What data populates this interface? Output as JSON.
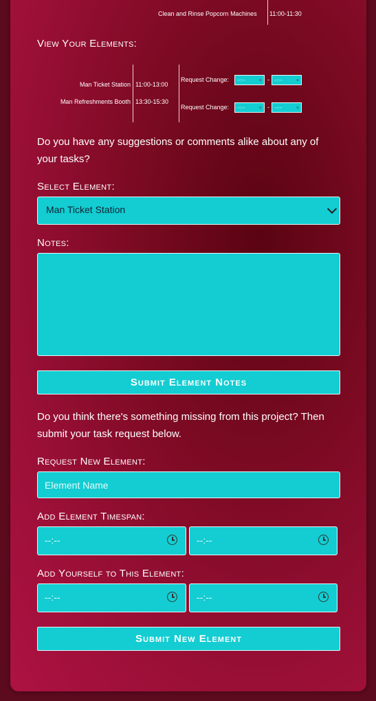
{
  "top_table": {
    "task": "Clean and Rinse Popcorn Machines",
    "time": "11:00-11:30"
  },
  "view_elements": {
    "heading": "View Your Elements:",
    "rows": [
      {
        "name": "Man Ticket Station",
        "time": "11:00-13:00"
      },
      {
        "name": "Man Refreshments Booth",
        "time": "13:30-15:30"
      }
    ],
    "request_change_label": "Request Change:",
    "separator": "-",
    "time_placeholder": "--:--",
    "clear_glyph": "×"
  },
  "suggestions": {
    "prompt": "Do you have any suggestions or comments alike about any of your tasks?",
    "select_label": "Select Element:",
    "select_value": "Man Ticket Station",
    "notes_label": "Notes:",
    "notes_value": "",
    "submit_label": "Submit Element Notes"
  },
  "new_element": {
    "prompt": "Do you think there's something missing from this project? Then submit your task request below.",
    "request_label": "Request New Element:",
    "name_placeholder": "Element Name",
    "timespan_label": "Add Element Timespan:",
    "time_placeholder": "--:--",
    "yourself_label": "Add Yourself to This Element:",
    "submit_label": "Submit New Element"
  },
  "colors": {
    "accent": "#13cdd2",
    "panel": "#8a0c2c",
    "background": "#5c0a1e"
  }
}
